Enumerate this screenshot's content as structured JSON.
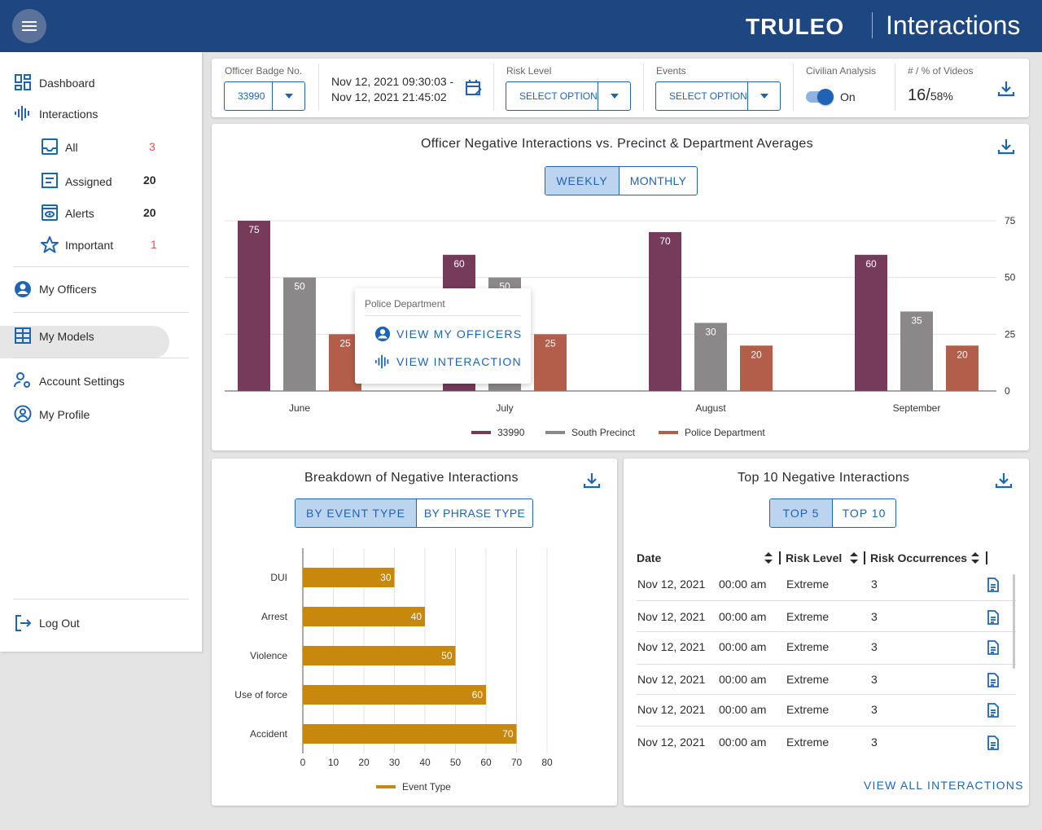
{
  "header": {
    "logo": "TRUL EO",
    "logo_text": "TRULEO",
    "title": "Interactions"
  },
  "sidebar": {
    "dashboard": "Dashboard",
    "interactions": "Interactions",
    "all": {
      "label": "All",
      "count": "3"
    },
    "assigned": {
      "label": "Assigned",
      "count": "20"
    },
    "alerts": {
      "label": "Alerts",
      "count": "20"
    },
    "important": {
      "label": "Important",
      "count": "1"
    },
    "my_officers": "My Officers",
    "my_models": "My Models",
    "account_settings": "Account Settings",
    "my_profile": "My Profile",
    "log_out": "Log Out"
  },
  "filters": {
    "badge_label": "Officer Badge No.",
    "badge_value": "33990",
    "date_start": "Nov 12, 2021 09:30:03 -",
    "date_end": "Nov 12, 2021 21:45:02",
    "risk_label": "Risk Level",
    "risk_value": "SELECT OPTION",
    "events_label": "Events",
    "events_value": "SELECT OPTION",
    "civilian_label": "Civilian Analysis",
    "civilian_value": "On",
    "videos_label": "# / % of Videos",
    "videos_count": "16/",
    "videos_pct": "58%"
  },
  "main_chart": {
    "title": "Officer Negative Interactions vs. Precinct & Department Averages",
    "toggle_weekly": "WEEKLY",
    "toggle_monthly": "MONTHLY",
    "popup_header": "Police Department",
    "popup_view_officers": "VIEW MY OFFICERS",
    "popup_view_interaction": "VIEW INTERACTION"
  },
  "breakdown": {
    "title": "Breakdown of Negative Interactions",
    "toggle_event": "BY EVENT TYPE",
    "toggle_phrase": "BY PHRASE TYPE"
  },
  "top10": {
    "title": "Top 10 Negative Interactions",
    "toggle_top5": "TOP 5",
    "toggle_top10": "TOP 10",
    "col_date": "Date",
    "col_risk": "Risk Level",
    "col_occ": "Risk Occurrences",
    "rows": [
      {
        "date": "Nov 12, 2021",
        "time": "00:00 am",
        "risk": "Extreme",
        "occ": "3"
      },
      {
        "date": "Nov 12, 2021",
        "time": "00:00 am",
        "risk": "Extreme",
        "occ": "3"
      },
      {
        "date": "Nov 12, 2021",
        "time": "00:00 am",
        "risk": "Extreme",
        "occ": "3"
      },
      {
        "date": "Nov 12, 2021",
        "time": "00:00 am",
        "risk": "Extreme",
        "occ": "3"
      },
      {
        "date": "Nov 12, 2021",
        "time": "00:00 am",
        "risk": "Extreme",
        "occ": "3"
      },
      {
        "date": "Nov 12, 2021",
        "time": "00:00 am",
        "risk": "Extreme",
        "occ": "3"
      }
    ],
    "view_all": "VIEW ALL INTERACTIONS"
  },
  "colors": {
    "header": "#1e4680",
    "accent": "#1e64b4",
    "officer": "#763a5a",
    "precinct": "#8a8889",
    "department": "#b35e4a",
    "event": "#c8870d",
    "count_red": "#d9534f"
  },
  "chart_data": [
    {
      "type": "bar",
      "categories": [
        "June",
        "July",
        "August",
        "September"
      ],
      "series": [
        {
          "name": "33990",
          "values": [
            75,
            60,
            70,
            60
          ]
        },
        {
          "name": "South Precinct",
          "values": [
            50,
            50,
            30,
            35
          ]
        },
        {
          "name": "Police Department",
          "values": [
            25,
            25,
            20,
            20
          ]
        }
      ],
      "ylim": [
        0,
        75
      ],
      "yticks": [
        "0",
        "25",
        "50",
        "75"
      ],
      "legend": "bottom",
      "grid": true
    },
    {
      "type": "bar",
      "orientation": "horizontal",
      "categories": [
        "DUI",
        "Arrest",
        "Violence",
        "Use of force",
        "Accident"
      ],
      "series": [
        {
          "name": "Event Type",
          "values": [
            30,
            40,
            50,
            60,
            70
          ]
        }
      ],
      "xlim": [
        0,
        80
      ],
      "xticks": [
        "0",
        "10",
        "20",
        "30",
        "40",
        "50",
        "60",
        "70",
        "80"
      ],
      "legend": "bottom",
      "grid": true
    }
  ]
}
